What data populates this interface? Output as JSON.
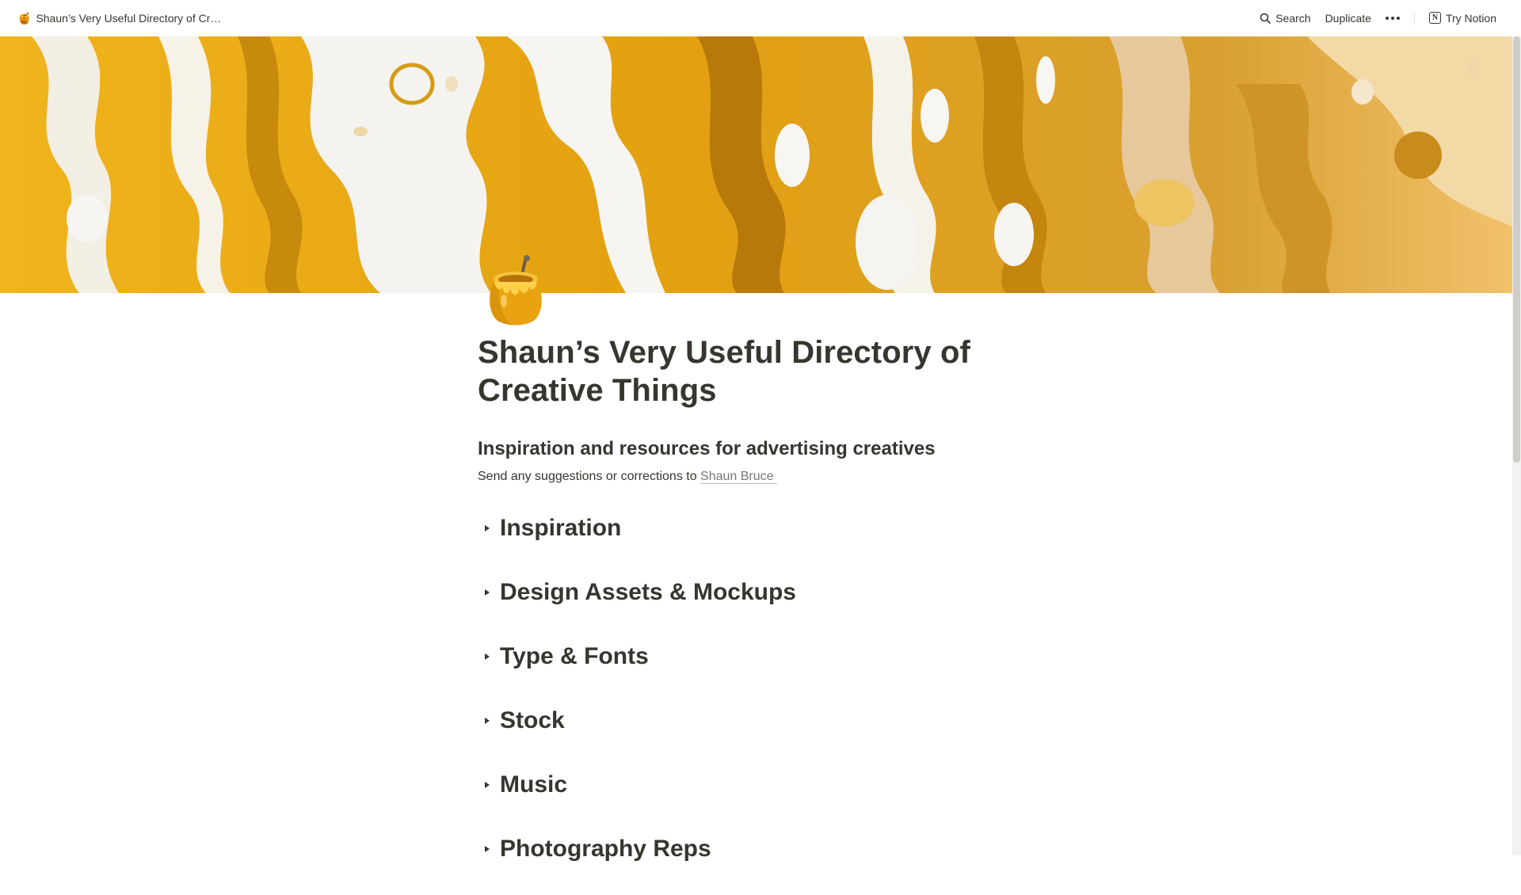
{
  "topbar": {
    "page_emoji": "🍯",
    "breadcrumb_title": "Shaun’s Very Useful Directory of Cr…",
    "search_label": "Search",
    "duplicate_label": "Duplicate",
    "try_notion_label": "Try Notion"
  },
  "page": {
    "icon": "honey-pot-icon",
    "title": "Shaun’s Very Useful Directory of Creative Things",
    "subtitle": "Inspiration and resources for advertising creatives",
    "contact_text": "Send any suggestions or corrections to ",
    "contact_link": "Shaun Bruce",
    "toggles": [
      {
        "label": "Inspiration"
      },
      {
        "label": "Design Assets & Mockups"
      },
      {
        "label": "Type & Fonts"
      },
      {
        "label": "Stock"
      },
      {
        "label": "Music"
      },
      {
        "label": "Photography Reps"
      }
    ]
  },
  "colors": {
    "text": "#37352f",
    "link": "#787774",
    "cover_gold": "#e9a91a",
    "cover_dark_gold": "#b9780a"
  }
}
